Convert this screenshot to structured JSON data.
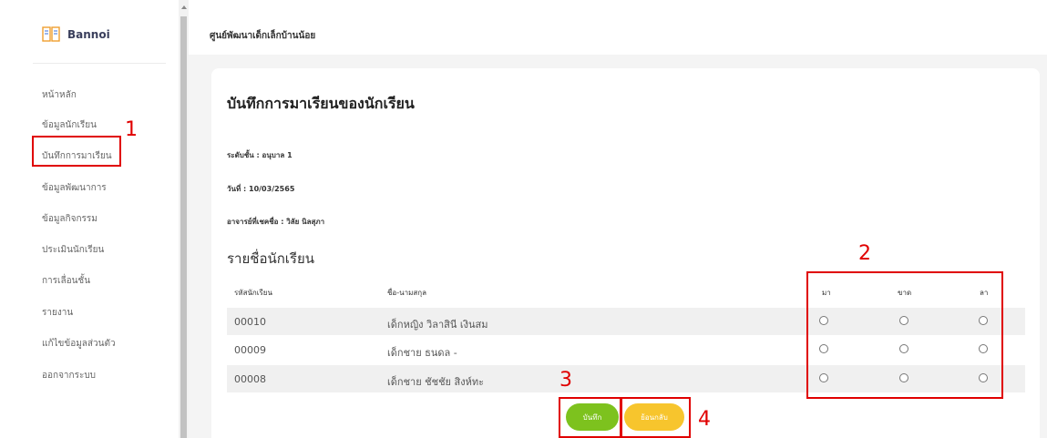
{
  "brand": {
    "name": "Bannoi"
  },
  "sidebar": {
    "items": [
      {
        "label": "หน้าหลัก"
      },
      {
        "label": "ข้อมูลนักเรียน"
      },
      {
        "label": "บันทึกการมาเรียน"
      },
      {
        "label": "ข้อมูลพัฒนาการ"
      },
      {
        "label": "ข้อมูลกิจกรรม"
      },
      {
        "label": "ประเมินนักเรียน"
      },
      {
        "label": "การเลื่อนชั้น"
      },
      {
        "label": "รายงาน"
      },
      {
        "label": "แก้ไขข้อมูลส่วนตัว"
      },
      {
        "label": "ออกจากระบบ"
      }
    ]
  },
  "header": {
    "title": "ศูนย์พัฒนาเด็กเล็กบ้านน้อย"
  },
  "page": {
    "title": "บันทึกการมาเรียนของนักเรียน",
    "level": "ระดับชั้น : อนุบาล 1",
    "date": "วันที่ : 10/03/2565",
    "teacher": "อาจารย์ที่เชคชื่อ : วิลัย นิลสุภา",
    "list_title": "รายชื่อนักเรียน"
  },
  "table": {
    "headers": {
      "id": "รหัสนักเรียน",
      "name": "ชื่อ-นามสกุล",
      "present": "มา",
      "absent": "ขาด",
      "leave": "ลา"
    },
    "rows": [
      {
        "id": "00010",
        "name": "เด็กหญิง วิลาสินี เงินสม"
      },
      {
        "id": "00009",
        "name": "เด็กชาย ธนดล -"
      },
      {
        "id": "00008",
        "name": "เด็กชาย ชัชชัย สิงห์ทะ"
      }
    ]
  },
  "buttons": {
    "save": "บันทึก",
    "back": "ย้อนกลับ"
  },
  "annotations": {
    "n1": "1",
    "n2": "2",
    "n3": "3",
    "n4": "4"
  },
  "colors": {
    "save": "#7dc21e",
    "back": "#f7c52d",
    "annotation": "#e00000"
  }
}
